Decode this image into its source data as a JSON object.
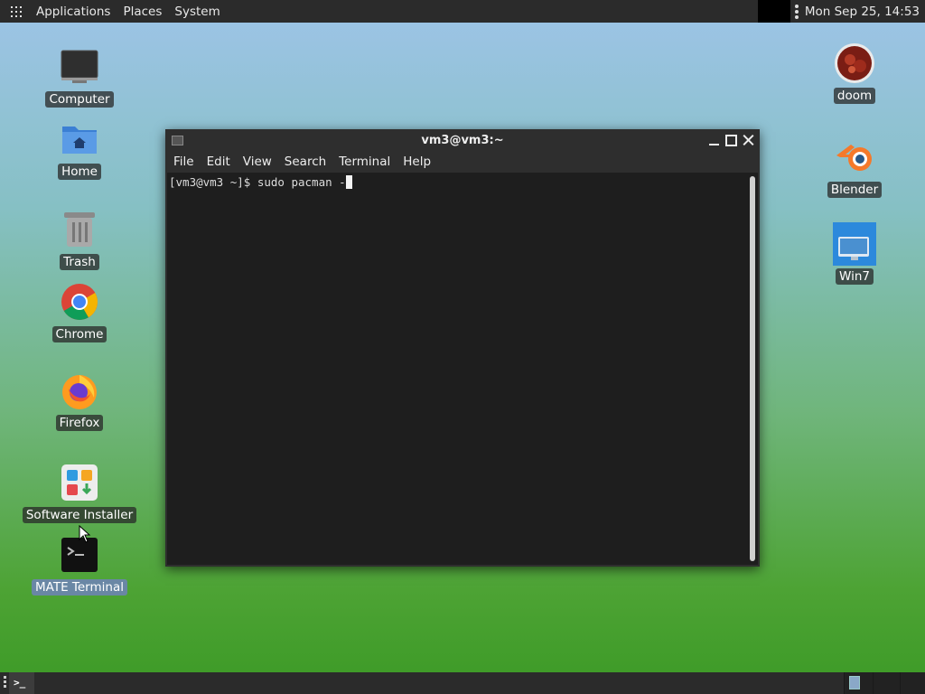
{
  "top_panel": {
    "menus": [
      "Applications",
      "Places",
      "System"
    ],
    "clock": "Mon Sep 25, 14:53"
  },
  "desktop_icons_left": [
    {
      "label": "Computer",
      "icon": "computer-icon"
    },
    {
      "label": "Home",
      "icon": "home-folder-icon"
    },
    {
      "label": "Trash",
      "icon": "trash-icon"
    },
    {
      "label": "Chrome",
      "icon": "chrome-icon"
    },
    {
      "label": "Firefox",
      "icon": "firefox-icon"
    },
    {
      "label": "Software Installer",
      "icon": "software-installer-icon"
    },
    {
      "label": "MATE Terminal",
      "icon": "terminal-icon",
      "selected": true
    }
  ],
  "desktop_icons_right": [
    {
      "label": "doom",
      "icon": "doom-icon"
    },
    {
      "label": "Blender",
      "icon": "blender-icon"
    },
    {
      "label": "Win7",
      "icon": "win7-icon"
    }
  ],
  "terminal": {
    "title": "vm3@vm3:~",
    "menu": [
      "File",
      "Edit",
      "View",
      "Search",
      "Terminal",
      "Help"
    ],
    "prompt_line": "[vm3@vm3 ~]$ sudo pacman -"
  },
  "colors": {
    "panel": "#2b2b2b",
    "terminal_bg": "#1e1e1e",
    "chrome_red": "#db4437",
    "chrome_green": "#0f9d58",
    "chrome_yellow": "#f4b400",
    "chrome_blue": "#4285f4"
  }
}
